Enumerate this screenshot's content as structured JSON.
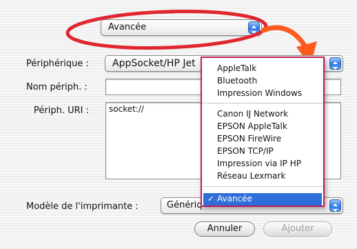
{
  "top_popup": {
    "value": "Avancée"
  },
  "form": {
    "device_label": "Périphérique :",
    "device_value": "AppSocket/HP Jet",
    "name_label": "Nom périph. :",
    "name_value": "",
    "uri_label": "Périph. URI :",
    "uri_value": "socket://",
    "model_label": "Modèle de l'imprimante :",
    "model_value": "Génériq"
  },
  "menu": {
    "group1": [
      "AppleTalk",
      "Bluetooth",
      "Impression Windows"
    ],
    "group2": [
      "Canon IJ Network",
      "EPSON AppleTalk",
      "EPSON FireWire",
      "EPSON TCP/IP",
      "Impression via IP HP",
      "Réseau Lexmark"
    ],
    "selected": "Avancée",
    "checkmark": "✓"
  },
  "buttons": {
    "cancel": "Annuler",
    "add": "Ajouter"
  },
  "colors": {
    "highlight_annotation": "#e0262e",
    "arrow_annotation": "#ff5a1f",
    "menu_border": "#c2185b",
    "selection": "#2f6ed8",
    "popup_arrow": "#2b78e4"
  },
  "icons": {
    "popup_arrows": "chevron-updown-icon",
    "annotation": "curved-arrow-icon"
  }
}
